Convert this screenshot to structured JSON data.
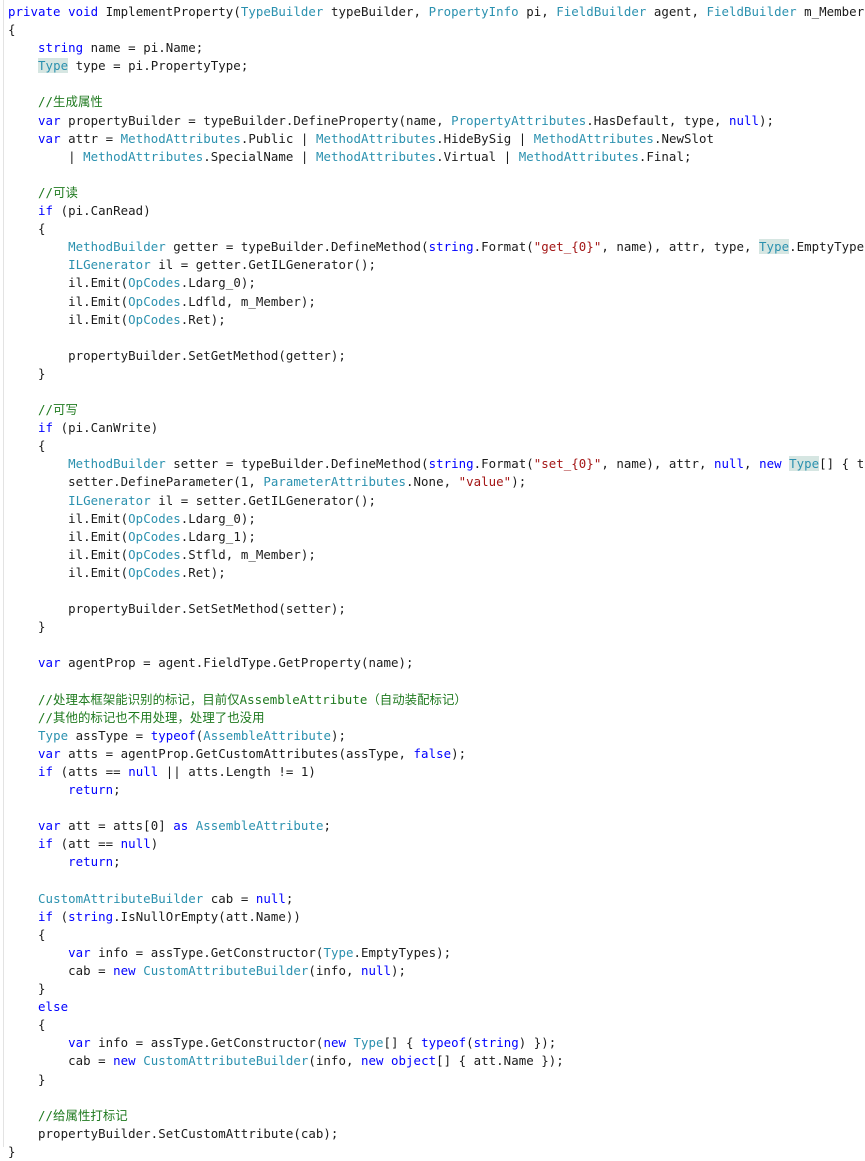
{
  "editor": {
    "language": "csharp",
    "title": "ImplementProperty",
    "colors": {
      "background": "#ffffff",
      "plain": "#1b1b1b",
      "keyword": "#0000ff",
      "type": "#2b91af",
      "string": "#a31515",
      "comment": "#1f7a1f",
      "highlight_background": "#d6e6e2",
      "margin_line": "#e3e3e3"
    },
    "font_size_px": 12.4,
    "line_height_px": 18.1,
    "total_lines": 63
  },
  "code": {
    "lines": [
      {
        "n": 1,
        "tokens": [
          {
            "t": "private",
            "c": "kw"
          },
          {
            "t": " "
          },
          {
            "t": "void",
            "c": "kw"
          },
          {
            "t": " ImplementProperty("
          },
          {
            "t": "TypeBuilder",
            "c": "typ"
          },
          {
            "t": " typeBuilder, "
          },
          {
            "t": "PropertyInfo",
            "c": "typ"
          },
          {
            "t": " pi, "
          },
          {
            "t": "FieldBuilder",
            "c": "typ"
          },
          {
            "t": " agent, "
          },
          {
            "t": "FieldBuilder",
            "c": "typ"
          },
          {
            "t": " m_Member)"
          }
        ]
      },
      {
        "n": 2,
        "tokens": [
          {
            "t": "{"
          }
        ]
      },
      {
        "n": 3,
        "tokens": [
          {
            "t": "    "
          },
          {
            "t": "string",
            "c": "kw"
          },
          {
            "t": " name = pi.Name;"
          }
        ]
      },
      {
        "n": 4,
        "tokens": [
          {
            "t": "    "
          },
          {
            "t": "Type",
            "c": "typ hl"
          },
          {
            "t": " type = pi.PropertyType;"
          }
        ]
      },
      {
        "n": 5,
        "tokens": []
      },
      {
        "n": 6,
        "tokens": [
          {
            "t": "    //生成属性",
            "c": "cmt"
          }
        ]
      },
      {
        "n": 7,
        "tokens": [
          {
            "t": "    "
          },
          {
            "t": "var",
            "c": "kw"
          },
          {
            "t": " propertyBuilder = typeBuilder.DefineProperty(name, "
          },
          {
            "t": "PropertyAttributes",
            "c": "typ"
          },
          {
            "t": ".HasDefault, type, "
          },
          {
            "t": "null",
            "c": "kw"
          },
          {
            "t": ");"
          }
        ]
      },
      {
        "n": 8,
        "tokens": [
          {
            "t": "    "
          },
          {
            "t": "var",
            "c": "kw"
          },
          {
            "t": " attr = "
          },
          {
            "t": "MethodAttributes",
            "c": "typ"
          },
          {
            "t": ".Public | "
          },
          {
            "t": "MethodAttributes",
            "c": "typ"
          },
          {
            "t": ".HideBySig | "
          },
          {
            "t": "MethodAttributes",
            "c": "typ"
          },
          {
            "t": ".NewSlot"
          }
        ]
      },
      {
        "n": 9,
        "tokens": [
          {
            "t": "        | "
          },
          {
            "t": "MethodAttributes",
            "c": "typ"
          },
          {
            "t": ".SpecialName | "
          },
          {
            "t": "MethodAttributes",
            "c": "typ"
          },
          {
            "t": ".Virtual | "
          },
          {
            "t": "MethodAttributes",
            "c": "typ"
          },
          {
            "t": ".Final;"
          }
        ]
      },
      {
        "n": 10,
        "tokens": []
      },
      {
        "n": 11,
        "tokens": [
          {
            "t": "    //可读",
            "c": "cmt"
          }
        ]
      },
      {
        "n": 12,
        "tokens": [
          {
            "t": "    "
          },
          {
            "t": "if",
            "c": "kw"
          },
          {
            "t": " (pi.CanRead)"
          }
        ]
      },
      {
        "n": 13,
        "tokens": [
          {
            "t": "    {"
          }
        ]
      },
      {
        "n": 14,
        "tokens": [
          {
            "t": "        "
          },
          {
            "t": "MethodBuilder",
            "c": "typ"
          },
          {
            "t": " getter = typeBuilder.DefineMethod("
          },
          {
            "t": "string",
            "c": "kw"
          },
          {
            "t": ".Format("
          },
          {
            "t": "\"get_{0}\"",
            "c": "str"
          },
          {
            "t": ", name), attr, type, "
          },
          {
            "t": "Type",
            "c": "typ hl"
          },
          {
            "t": ".EmptyTypes);"
          }
        ]
      },
      {
        "n": 15,
        "tokens": [
          {
            "t": "        "
          },
          {
            "t": "ILGenerator",
            "c": "typ"
          },
          {
            "t": " il = getter.GetILGenerator();"
          }
        ]
      },
      {
        "n": 16,
        "tokens": [
          {
            "t": "        il.Emit("
          },
          {
            "t": "OpCodes",
            "c": "typ"
          },
          {
            "t": ".Ldarg_0);"
          }
        ]
      },
      {
        "n": 17,
        "tokens": [
          {
            "t": "        il.Emit("
          },
          {
            "t": "OpCodes",
            "c": "typ"
          },
          {
            "t": ".Ldfld, m_Member);"
          }
        ]
      },
      {
        "n": 18,
        "tokens": [
          {
            "t": "        il.Emit("
          },
          {
            "t": "OpCodes",
            "c": "typ"
          },
          {
            "t": ".Ret);"
          }
        ]
      },
      {
        "n": 19,
        "tokens": []
      },
      {
        "n": 20,
        "tokens": [
          {
            "t": "        propertyBuilder.SetGetMethod(getter);"
          }
        ]
      },
      {
        "n": 21,
        "tokens": [
          {
            "t": "    }"
          }
        ]
      },
      {
        "n": 22,
        "tokens": []
      },
      {
        "n": 23,
        "tokens": [
          {
            "t": "    //可写",
            "c": "cmt"
          }
        ]
      },
      {
        "n": 24,
        "tokens": [
          {
            "t": "    "
          },
          {
            "t": "if",
            "c": "kw"
          },
          {
            "t": " (pi.CanWrite)"
          }
        ]
      },
      {
        "n": 25,
        "tokens": [
          {
            "t": "    {"
          }
        ]
      },
      {
        "n": 26,
        "tokens": [
          {
            "t": "        "
          },
          {
            "t": "MethodBuilder",
            "c": "typ"
          },
          {
            "t": " setter = typeBuilder.DefineMethod("
          },
          {
            "t": "string",
            "c": "kw"
          },
          {
            "t": ".Format("
          },
          {
            "t": "\"set_{0}\"",
            "c": "str"
          },
          {
            "t": ", name), attr, "
          },
          {
            "t": "null",
            "c": "kw"
          },
          {
            "t": ", "
          },
          {
            "t": "new",
            "c": "kw"
          },
          {
            "t": " "
          },
          {
            "t": "Type",
            "c": "typ hl"
          },
          {
            "t": "[] { type });"
          }
        ]
      },
      {
        "n": 27,
        "tokens": [
          {
            "t": "        setter.DefineParameter(1, "
          },
          {
            "t": "ParameterAttributes",
            "c": "typ"
          },
          {
            "t": ".None, "
          },
          {
            "t": "\"value\"",
            "c": "str"
          },
          {
            "t": ");"
          }
        ]
      },
      {
        "n": 28,
        "tokens": [
          {
            "t": "        "
          },
          {
            "t": "ILGenerator",
            "c": "typ"
          },
          {
            "t": " il = setter.GetILGenerator();"
          }
        ]
      },
      {
        "n": 29,
        "tokens": [
          {
            "t": "        il.Emit("
          },
          {
            "t": "OpCodes",
            "c": "typ"
          },
          {
            "t": ".Ldarg_0);"
          }
        ]
      },
      {
        "n": 30,
        "tokens": [
          {
            "t": "        il.Emit("
          },
          {
            "t": "OpCodes",
            "c": "typ"
          },
          {
            "t": ".Ldarg_1);"
          }
        ]
      },
      {
        "n": 31,
        "tokens": [
          {
            "t": "        il.Emit("
          },
          {
            "t": "OpCodes",
            "c": "typ"
          },
          {
            "t": ".Stfld, m_Member);"
          }
        ]
      },
      {
        "n": 32,
        "tokens": [
          {
            "t": "        il.Emit("
          },
          {
            "t": "OpCodes",
            "c": "typ"
          },
          {
            "t": ".Ret);"
          }
        ]
      },
      {
        "n": 33,
        "tokens": []
      },
      {
        "n": 34,
        "tokens": [
          {
            "t": "        propertyBuilder.SetSetMethod(setter);"
          }
        ]
      },
      {
        "n": 35,
        "tokens": [
          {
            "t": "    }"
          }
        ]
      },
      {
        "n": 36,
        "tokens": []
      },
      {
        "n": 37,
        "tokens": [
          {
            "t": "    "
          },
          {
            "t": "var",
            "c": "kw"
          },
          {
            "t": " agentProp = agent.FieldType.GetProperty(name);"
          }
        ]
      },
      {
        "n": 38,
        "tokens": []
      },
      {
        "n": 39,
        "tokens": [
          {
            "t": "    //处理本框架能识别的标记，目前仅AssembleAttribute（自动装配标记）",
            "c": "cmt"
          }
        ]
      },
      {
        "n": 40,
        "tokens": [
          {
            "t": "    //其他的标记也不用处理，处理了也没用",
            "c": "cmt"
          }
        ]
      },
      {
        "n": 41,
        "tokens": [
          {
            "t": "    "
          },
          {
            "t": "Type",
            "c": "typ"
          },
          {
            "t": " assType = "
          },
          {
            "t": "typeof",
            "c": "kw"
          },
          {
            "t": "("
          },
          {
            "t": "AssembleAttribute",
            "c": "typ"
          },
          {
            "t": ");"
          }
        ]
      },
      {
        "n": 42,
        "tokens": [
          {
            "t": "    "
          },
          {
            "t": "var",
            "c": "kw"
          },
          {
            "t": " atts = agentProp.GetCustomAttributes(assType, "
          },
          {
            "t": "false",
            "c": "kw"
          },
          {
            "t": ");"
          }
        ]
      },
      {
        "n": 43,
        "tokens": [
          {
            "t": "    "
          },
          {
            "t": "if",
            "c": "kw"
          },
          {
            "t": " (atts == "
          },
          {
            "t": "null",
            "c": "kw"
          },
          {
            "t": " || atts.Length != 1)"
          }
        ]
      },
      {
        "n": 44,
        "tokens": [
          {
            "t": "        "
          },
          {
            "t": "return",
            "c": "kw"
          },
          {
            "t": ";"
          }
        ]
      },
      {
        "n": 45,
        "tokens": []
      },
      {
        "n": 46,
        "tokens": [
          {
            "t": "    "
          },
          {
            "t": "var",
            "c": "kw"
          },
          {
            "t": " att = atts[0] "
          },
          {
            "t": "as",
            "c": "kw"
          },
          {
            "t": " "
          },
          {
            "t": "AssembleAttribute",
            "c": "typ"
          },
          {
            "t": ";"
          }
        ]
      },
      {
        "n": 47,
        "tokens": [
          {
            "t": "    "
          },
          {
            "t": "if",
            "c": "kw"
          },
          {
            "t": " (att == "
          },
          {
            "t": "null",
            "c": "kw"
          },
          {
            "t": ")"
          }
        ]
      },
      {
        "n": 48,
        "tokens": [
          {
            "t": "        "
          },
          {
            "t": "return",
            "c": "kw"
          },
          {
            "t": ";"
          }
        ]
      },
      {
        "n": 49,
        "tokens": []
      },
      {
        "n": 50,
        "tokens": [
          {
            "t": "    "
          },
          {
            "t": "CustomAttributeBuilder",
            "c": "typ"
          },
          {
            "t": " cab = "
          },
          {
            "t": "null",
            "c": "kw"
          },
          {
            "t": ";"
          }
        ]
      },
      {
        "n": 51,
        "tokens": [
          {
            "t": "    "
          },
          {
            "t": "if",
            "c": "kw"
          },
          {
            "t": " ("
          },
          {
            "t": "string",
            "c": "kw"
          },
          {
            "t": ".IsNullOrEmpty(att.Name))"
          }
        ]
      },
      {
        "n": 52,
        "tokens": [
          {
            "t": "    {"
          }
        ]
      },
      {
        "n": 53,
        "tokens": [
          {
            "t": "        "
          },
          {
            "t": "var",
            "c": "kw"
          },
          {
            "t": " info = assType.GetConstructor("
          },
          {
            "t": "Type",
            "c": "typ"
          },
          {
            "t": ".EmptyTypes);"
          }
        ]
      },
      {
        "n": 54,
        "tokens": [
          {
            "t": "        cab = "
          },
          {
            "t": "new",
            "c": "kw"
          },
          {
            "t": " "
          },
          {
            "t": "CustomAttributeBuilder",
            "c": "typ"
          },
          {
            "t": "(info, "
          },
          {
            "t": "null",
            "c": "kw"
          },
          {
            "t": ");"
          }
        ]
      },
      {
        "n": 55,
        "tokens": [
          {
            "t": "    }"
          }
        ]
      },
      {
        "n": 56,
        "tokens": [
          {
            "t": "    "
          },
          {
            "t": "else",
            "c": "kw"
          }
        ]
      },
      {
        "n": 57,
        "tokens": [
          {
            "t": "    {"
          }
        ]
      },
      {
        "n": 58,
        "tokens": [
          {
            "t": "        "
          },
          {
            "t": "var",
            "c": "kw"
          },
          {
            "t": " info = assType.GetConstructor("
          },
          {
            "t": "new",
            "c": "kw"
          },
          {
            "t": " "
          },
          {
            "t": "Type",
            "c": "typ"
          },
          {
            "t": "[] { "
          },
          {
            "t": "typeof",
            "c": "kw"
          },
          {
            "t": "("
          },
          {
            "t": "string",
            "c": "kw"
          },
          {
            "t": ") });"
          }
        ]
      },
      {
        "n": 59,
        "tokens": [
          {
            "t": "        cab = "
          },
          {
            "t": "new",
            "c": "kw"
          },
          {
            "t": " "
          },
          {
            "t": "CustomAttributeBuilder",
            "c": "typ"
          },
          {
            "t": "(info, "
          },
          {
            "t": "new",
            "c": "kw"
          },
          {
            "t": " "
          },
          {
            "t": "object",
            "c": "kw"
          },
          {
            "t": "[] { att.Name });"
          }
        ]
      },
      {
        "n": 60,
        "tokens": [
          {
            "t": "    }"
          }
        ]
      },
      {
        "n": 61,
        "tokens": []
      },
      {
        "n": 62,
        "tokens": [
          {
            "t": "    //给属性打标记",
            "c": "cmt"
          }
        ]
      },
      {
        "n": 63,
        "tokens": [
          {
            "t": "    propertyBuilder.SetCustomAttribute(cab);"
          }
        ]
      },
      {
        "n": 64,
        "tokens": [
          {
            "t": "}"
          }
        ]
      }
    ]
  }
}
